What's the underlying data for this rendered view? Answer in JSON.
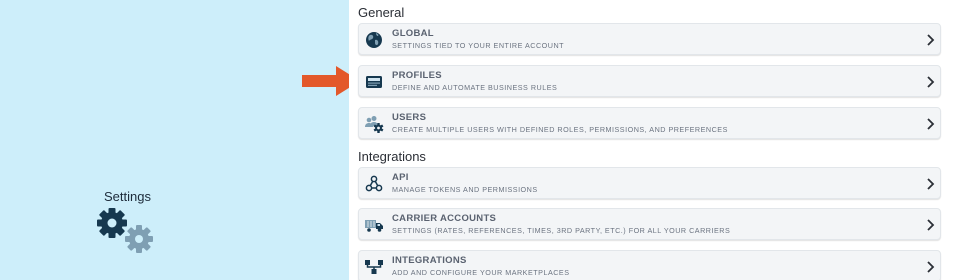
{
  "sidebar": {
    "title": "Settings",
    "icon": "gears-icon"
  },
  "colors": {
    "accent_arrow": "#e3582a",
    "sidebar_bg": "#cdeefa",
    "icon_dark": "#16384f",
    "icon_light": "#7f9fb3"
  },
  "sections": {
    "general": {
      "title": "General",
      "items": [
        {
          "title": "GLOBAL",
          "subtitle": "SETTINGS TIED TO YOUR ENTIRE ACCOUNT",
          "icon": "globe-icon"
        },
        {
          "title": "PROFILES",
          "subtitle": "DEFINE AND AUTOMATE BUSINESS RULES",
          "icon": "profile-card-icon"
        },
        {
          "title": "USERS",
          "subtitle": "CREATE MULTIPLE USERS WITH DEFINED ROLES, PERMISSIONS, AND PREFERENCES",
          "icon": "users-gear-icon"
        }
      ]
    },
    "integrations": {
      "title": "Integrations",
      "items": [
        {
          "title": "API",
          "subtitle": "MANAGE TOKENS AND PERMISSIONS",
          "icon": "api-nodes-icon"
        },
        {
          "title": "CARRIER ACCOUNTS",
          "subtitle": "SETTINGS (RATES, REFERENCES, TIMES, 3RD PARTY, ETC.) FOR ALL YOUR CARRIERS",
          "icon": "truck-icon"
        },
        {
          "title": "INTEGRATIONS",
          "subtitle": "ADD AND CONFIGURE YOUR MARKETPLACES",
          "icon": "sitemap-icon"
        }
      ]
    }
  }
}
